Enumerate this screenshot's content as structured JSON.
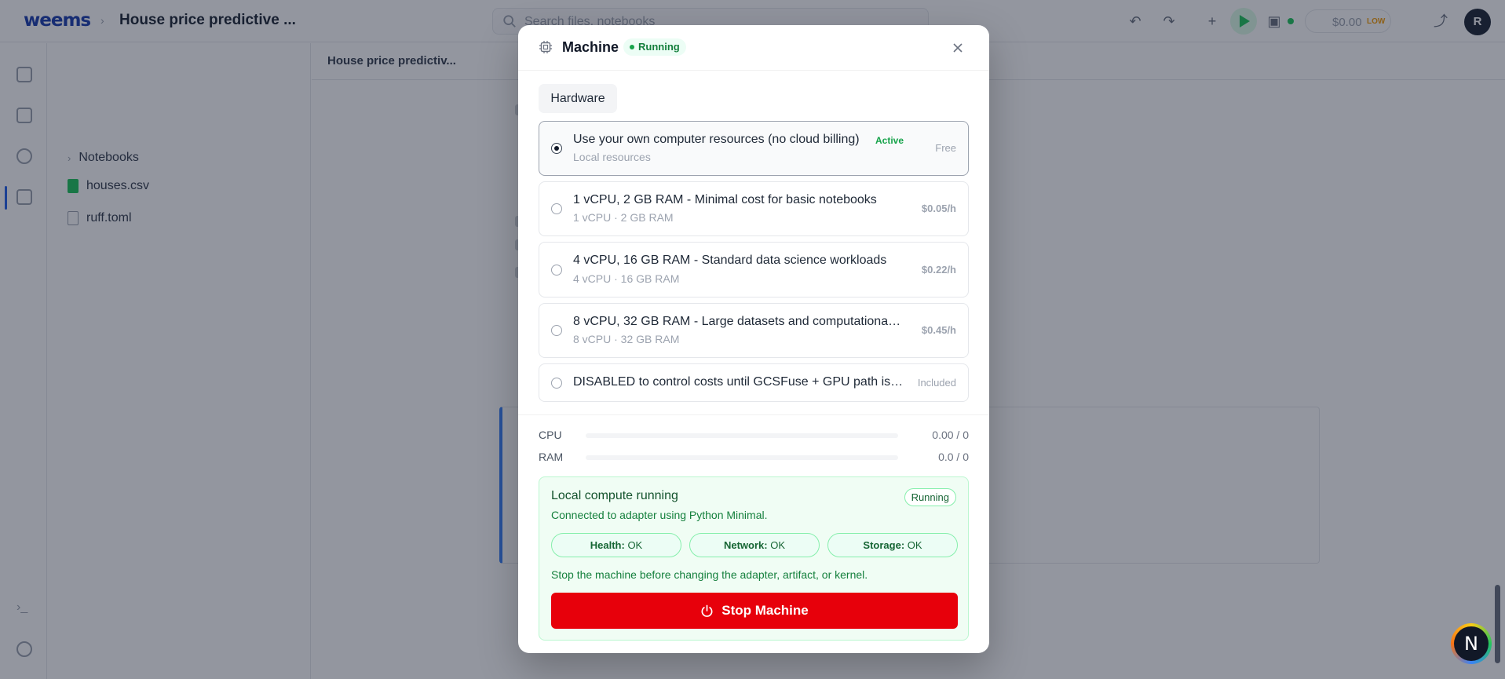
{
  "app": {
    "logo": "weems",
    "crumb_separator": "›",
    "doc_title": "House price predictive ...",
    "search_placeholder": "Search files, notebooks",
    "cost": "$0.00",
    "cost_level": "LOW",
    "avatar_initial": "R",
    "fab_initial": "N"
  },
  "files": {
    "items": [
      {
        "label": "Notebooks",
        "kind": "folder"
      },
      {
        "label": "houses.csv",
        "kind": "csv"
      },
      {
        "label": "ruff.toml",
        "kind": "file"
      }
    ]
  },
  "tabs": [
    {
      "label": "House price predictiv..."
    }
  ],
  "modal": {
    "title": "Machine",
    "status": "Running",
    "section_tab": "Hardware",
    "options": [
      {
        "title": "Use your own computer resources (no cloud billing)",
        "badge": "Active",
        "subtitle": "Local resources",
        "price": "Free",
        "selected": true
      },
      {
        "title": "1 vCPU, 2 GB RAM - Minimal cost for basic notebooks",
        "subtitle": "1 vCPU · 2 GB RAM",
        "price": "$0.05/h",
        "selected": false
      },
      {
        "title": "4 vCPU, 16 GB RAM - Standard data science workloads",
        "subtitle": "4 vCPU · 16 GB RAM",
        "price": "$0.22/h",
        "selected": false
      },
      {
        "title": "8 vCPU, 32 GB RAM - Large datasets and computational ...",
        "subtitle": "8 vCPU · 32 GB RAM",
        "price": "$0.45/h",
        "selected": false
      },
      {
        "title": "DISABLED to control costs until GCSFuse + GPU path is fi...",
        "price": "Included",
        "selected": false
      }
    ],
    "meters": [
      {
        "label": "CPU",
        "value": "0.00 / 0",
        "fraction": 0
      },
      {
        "label": "RAM",
        "value": "0.0 / 0",
        "fraction": 0
      }
    ],
    "compute": {
      "title": "Local compute running",
      "badge": "Running",
      "description": "Connected to adapter using Python Minimal.",
      "checks": [
        {
          "label": "Health:",
          "value": "OK"
        },
        {
          "label": "Network:",
          "value": "OK"
        },
        {
          "label": "Storage:",
          "value": "OK"
        }
      ],
      "note": "Stop the machine before changing the adapter, artifact, or kernel.",
      "stop_label": "Stop Machine"
    }
  },
  "colors": {
    "accent": "#2563eb",
    "success": "#16a34a",
    "danger": "#e7000b"
  }
}
